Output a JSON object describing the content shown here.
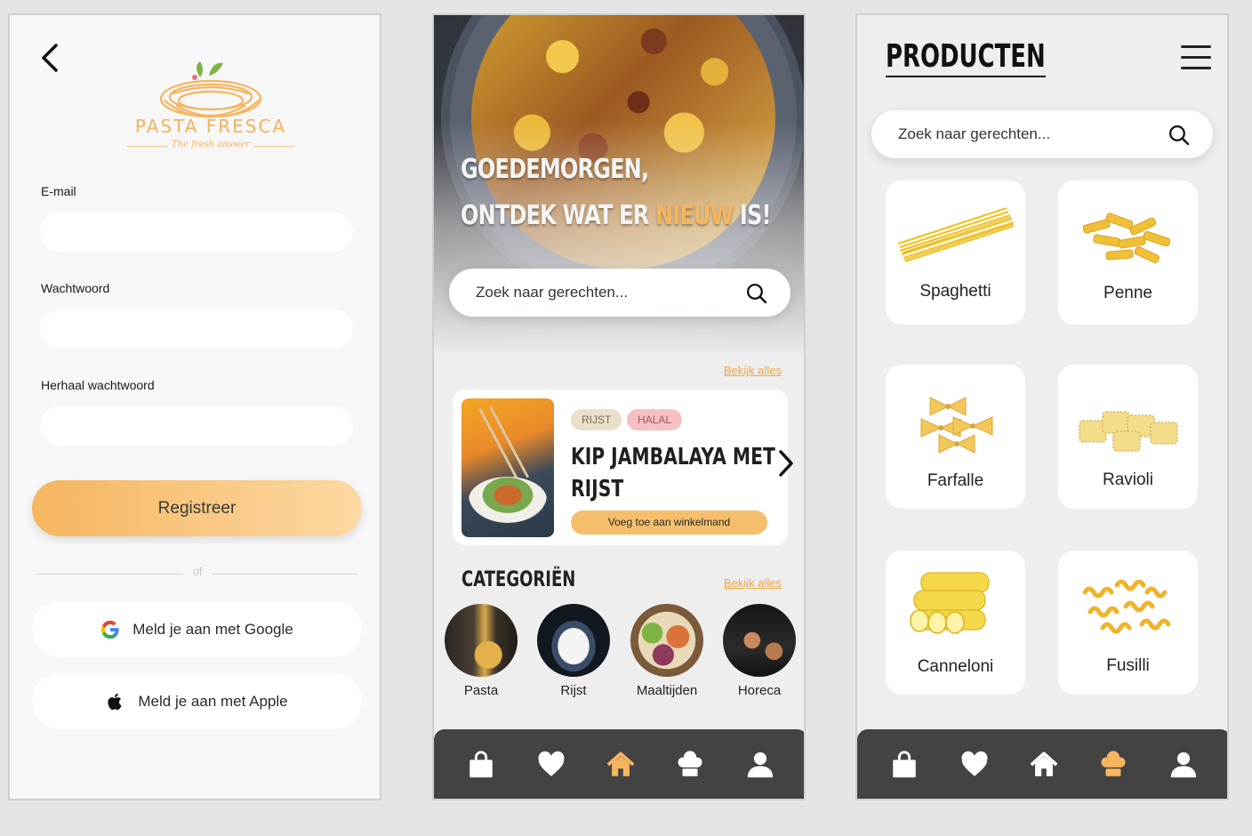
{
  "login": {
    "brand": "PASTA FRESCA",
    "tagline": "The fresh answer",
    "email_label": "E-mail",
    "password_label": "Wachtwoord",
    "repeat_password_label": "Herhaal wachtwoord",
    "register_label": "Registreer",
    "or_label": "of",
    "google_label": "Meld je aan met Google",
    "apple_label": "Meld je aan met Apple",
    "accent_color": "#f5b55f"
  },
  "home": {
    "headline_line1": "GOEDEMORGEN,",
    "headline_line2_pre": "ONTDEK WAT ER ",
    "headline_accent": "NIEUW",
    "headline_line2_post": " IS!",
    "search_placeholder": "Zoek naar gerechten...",
    "see_all_1": "Bekijk alles",
    "featured": {
      "tags": [
        "RIJST",
        "HALAL"
      ],
      "title_line1": "KIP JAMBALAYA MET",
      "title_line2": "RIJST",
      "button": "Voeg toe aan winkelmand"
    },
    "categories_title": "CATEGORIËN",
    "see_all_2": "Bekijk alles",
    "categories": [
      {
        "label": "Pasta"
      },
      {
        "label": "Rijst"
      },
      {
        "label": "Maaltijden"
      },
      {
        "label": "Horeca"
      }
    ],
    "nav": [
      "bag-icon",
      "heart-icon",
      "home-icon",
      "chef-hat-icon",
      "user-icon"
    ],
    "nav_active": "home-icon"
  },
  "products": {
    "title": "PRODUCTEN",
    "search_placeholder": "Zoek naar gerechten...",
    "items": [
      {
        "label": "Spaghetti"
      },
      {
        "label": "Penne"
      },
      {
        "label": "Farfalle"
      },
      {
        "label": "Ravioli"
      },
      {
        "label": "Canneloni"
      },
      {
        "label": "Fusilli"
      }
    ],
    "nav_active": "chef-hat-icon"
  },
  "colors": {
    "accent": "#f5b55f",
    "nav_bg": "#434343",
    "link": "#f0a640"
  }
}
